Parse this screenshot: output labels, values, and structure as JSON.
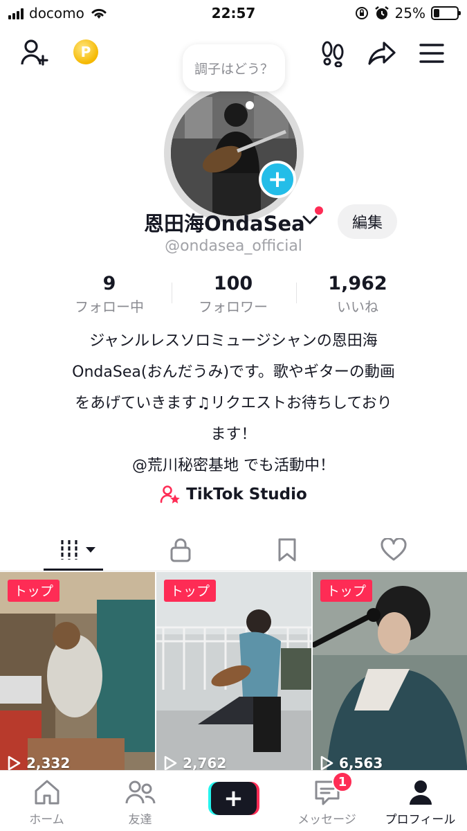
{
  "status_bar": {
    "carrier": "docomo",
    "time": "22:57",
    "battery_percent": "25%",
    "battery_level": 0.25
  },
  "header": {
    "add_friend_icon": "person-plus-icon",
    "coin_label": "P",
    "footprints_icon": "footprints-icon",
    "share_icon": "share-arrow-icon",
    "menu_icon": "hamburger-menu-icon"
  },
  "profile": {
    "status_bubble": "調子はどう？",
    "display_name": "恩田海OndaSea",
    "handle": "@ondasea_official",
    "edit_label": "編集"
  },
  "stats": [
    {
      "value": "9",
      "label": "フォロー中"
    },
    {
      "value": "100",
      "label": "フォロワー"
    },
    {
      "value": "1,962",
      "label": "いいね"
    }
  ],
  "bio": {
    "lines": [
      "ジャンルレスソロミュージシャンの恩田海",
      "OndaSea(おんだうみ)です。歌やギターの動画",
      "をあげていきます♫リクエストお待ちしており",
      "ます！",
      "@荒川秘密基地 でも活動中！"
    ]
  },
  "studio": {
    "label": "TikTok Studio"
  },
  "tabs": [
    {
      "icon": "videos-grid-icon"
    },
    {
      "icon": "lock-icon"
    },
    {
      "icon": "bookmark-icon"
    },
    {
      "icon": "heart-icon"
    }
  ],
  "videos": [
    {
      "tag": "トップ",
      "views": "2,332"
    },
    {
      "tag": "トップ",
      "views": "2,762"
    },
    {
      "tag": "トップ",
      "views": "6,563"
    }
  ],
  "bottom_nav": {
    "home": "ホーム",
    "friends": "友達",
    "messages": "メッセージ",
    "messages_badge": "1",
    "profile": "プロフィール"
  },
  "colors": {
    "accent": "#fe2c55",
    "cyan": "#25f4ee",
    "plus_blue": "#23bde8"
  }
}
